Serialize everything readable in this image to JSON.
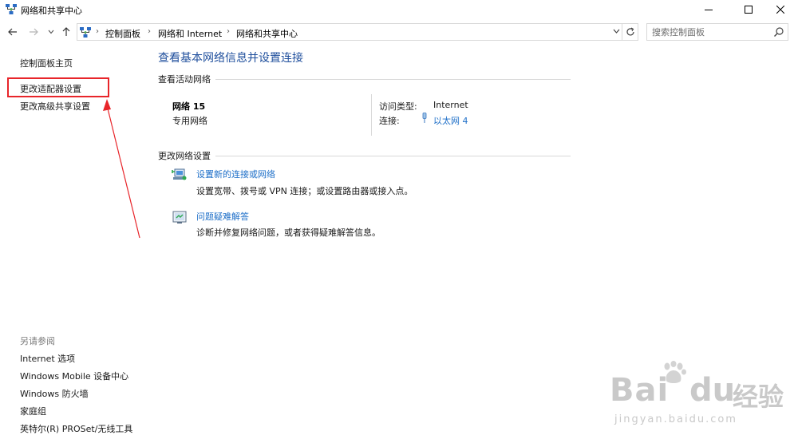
{
  "window": {
    "title": "网络和共享中心",
    "controls": [
      "minimize",
      "maximize",
      "close"
    ]
  },
  "address_bar": {
    "breadcrumbs": [
      "控制面板",
      "网络和 Internet",
      "网络和共享中心"
    ],
    "search_placeholder": "搜索控制面板"
  },
  "left_nav": {
    "items": [
      "控制面板主页",
      "更改适配器设置",
      "更改高级共享设置"
    ],
    "highlighted_item": "更改适配器设置",
    "see_also_title": "另请参阅",
    "see_also": [
      "Internet 选项",
      "Windows Mobile 设备中心",
      "Windows 防火墙",
      "家庭组",
      "英特尔(R) PROSet/无线工具"
    ]
  },
  "main": {
    "title": "查看基本网络信息并设置连接",
    "active_networks_heading": "查看活动网络",
    "network": {
      "name": "网络  15",
      "type": "专用网络",
      "access_type_label": "访问类型:",
      "access_type_value": "Internet",
      "connections_label": "连接:",
      "connections_value": "以太网 4"
    },
    "change_settings_heading": "更改网络设置",
    "tasks": [
      {
        "title": "设置新的连接或网络",
        "description": "设置宽带、拨号或 VPN 连接；或设置路由器或接入点。",
        "icon": "new-connection-icon"
      },
      {
        "title": "问题疑难解答",
        "description": "诊断并修复网络问题，或者获得疑难解答信息。",
        "icon": "troubleshoot-icon"
      }
    ]
  },
  "watermark": {
    "brand": "Bai",
    "brand_end": "du",
    "product": "经验",
    "url": "jingyan.baidu.com"
  },
  "colors": {
    "link": "#1e6fc8",
    "title": "#1e4e9c",
    "highlight": "#e8252a",
    "watermark": "#c9c9c9"
  }
}
